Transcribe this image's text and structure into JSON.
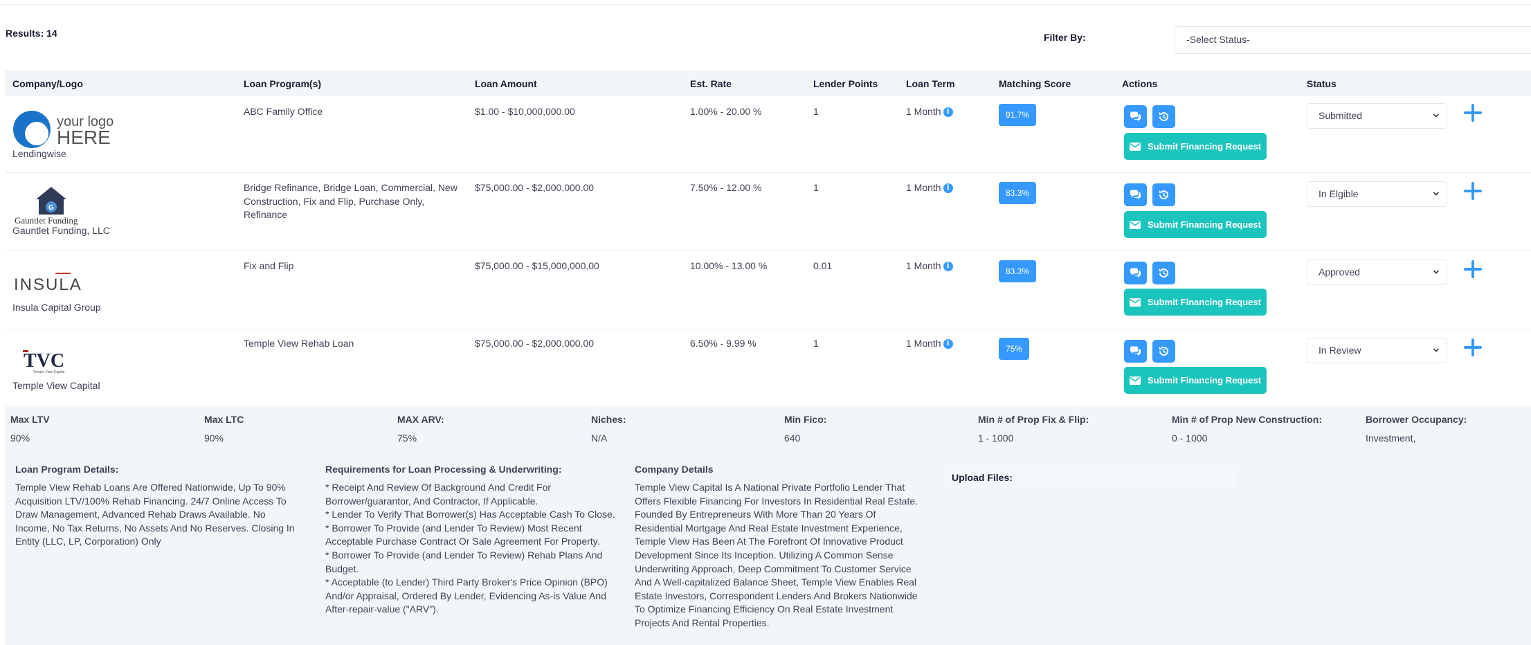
{
  "results_label": "Results: 14",
  "filter": {
    "label": "Filter By:",
    "placeholder": "-Select Status-"
  },
  "columns": [
    "Company/Logo",
    "Loan Program(s)",
    "Loan Amount",
    "Est. Rate",
    "Lender Points",
    "Loan Term",
    "Matching Score",
    "Actions",
    "Status"
  ],
  "rows": [
    {
      "logo": {
        "line1": "your logo",
        "line2": "HERE"
      },
      "company": "Lendingwise",
      "program": "ABC Family Office",
      "amount": "$1.00 - $10,000,000.00",
      "rate": "1.00% - 20.00 %",
      "points": "1",
      "term": "1 Month",
      "score": "91.7%",
      "submit_label": "Submit Financing Request",
      "status": "Submitted"
    },
    {
      "logo": {
        "text": "Gauntlet Funding"
      },
      "company": "Gauntlet Funding, LLC",
      "program": "Bridge Refinance, Bridge Loan, Commercial, New Construction, Fix and Flip, Purchase Only, Refinance",
      "amount": "$75,000.00 - $2,000,000.00",
      "rate": "7.50% - 12.00 %",
      "points": "1",
      "term": "1 Month",
      "score": "83.3%",
      "submit_label": "Submit Financing Request",
      "status": "In Elgible"
    },
    {
      "logo": {
        "text": "INSULA"
      },
      "company": "Insula Capital Group",
      "program": "Fix and Flip",
      "amount": "$75,000.00 - $15,000,000.00",
      "rate": "10.00% - 13.00 %",
      "points": "0.01",
      "term": "1 Month",
      "score": "83.3%",
      "submit_label": "Submit Financing Request",
      "status": "Approved"
    },
    {
      "logo": {
        "text": "TVC",
        "tagline": "Temple View Capital"
      },
      "company": "Temple View Capital",
      "program": "Temple View Rehab Loan",
      "amount": "$75,000.00 - $2,000,000.00",
      "rate": "6.50% - 9.99 %",
      "points": "1",
      "term": "1 Month",
      "score": "75%",
      "submit_label": "Submit Financing Request",
      "status": "In Review"
    }
  ],
  "specs": [
    {
      "label": "Max LTV",
      "value": "90%"
    },
    {
      "label": "Max LTC",
      "value": "90%"
    },
    {
      "label": "MAX ARV:",
      "value": "75%"
    },
    {
      "label": "Niches:",
      "value": "N/A"
    },
    {
      "label": "Min Fico:",
      "value": "640"
    },
    {
      "label": "Min # of Prop Fix & Flip:",
      "value": "1 - 1000"
    },
    {
      "label": "Min # of Prop New Construction:",
      "value": "0 - 1000"
    },
    {
      "label": "Borrower Occupancy:",
      "value": "Investment,"
    }
  ],
  "program_details": {
    "title": "Loan Program Details:",
    "text": "Temple View Rehab Loans Are Offered Nationwide, Up To 90% Acquisition LTV/100% Rehab Financing. 24/7 Online Access To Draw Management, Advanced Rehab Draws Available. No Income, No Tax Returns, No Assets And No Reserves. Closing In Entity (LLC, LP, Corporation) Only"
  },
  "requirements": {
    "title": "Requirements for Loan Processing & Underwriting:",
    "items": [
      "* Receipt And Review Of Background And Credit For Borrower/guarantor, And Contractor, If Applicable.",
      "* Lender To Verify That Borrower(s) Has Acceptable Cash To Close.",
      "* Borrower To Provide (and Lender To Review) Most Recent Acceptable Purchase Contract Or Sale Agreement For Property.",
      "* Borrower To Provide (and Lender To Review) Rehab Plans And Budget.",
      "* Acceptable (to Lender) Third Party Broker's Price Opinion (BPO) And/or Appraisal, Ordered By Lender, Evidencing As-is Value And After-repair-value (\"ARV\")."
    ]
  },
  "company_details": {
    "title": "Company Details",
    "text": "Temple View Capital Is A National Private Portfolio Lender That Offers Flexible Financing For Investors In Residential Real Estate. Founded By Entrepreneurs With More Than 20 Years Of Residential Mortgage And Real Estate Investment Experience, Temple View Has Been At The Forefront Of Innovative Product Development Since Its Inception. Utilizing A Common Sense Underwriting Approach, Deep Commitment To Customer Service And A Well-capitalized Balance Sheet, Temple View Enables Real Estate Investors, Correspondent Lenders And Brokers Nationwide To Optimize Financing Efficiency On Real Estate Investment Projects And Rental Properties."
  },
  "upload": {
    "label": "Upload Files:"
  },
  "colors": {
    "primary": "#3699ff",
    "success": "#1bc5bd",
    "header_bg": "#f3f6f9"
  }
}
